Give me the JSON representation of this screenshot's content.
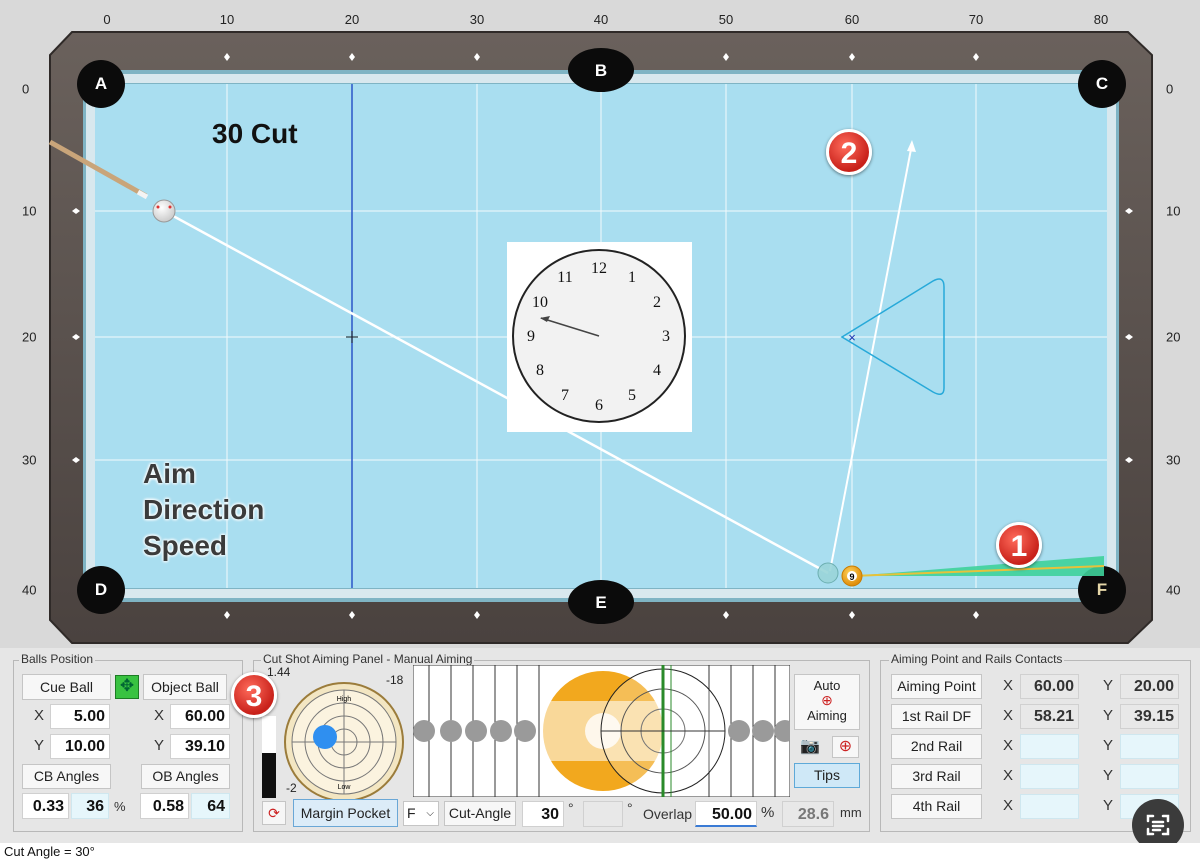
{
  "ruler": {
    "x_ticks": [
      "0",
      "10",
      "20",
      "30",
      "40",
      "50",
      "60",
      "70",
      "80"
    ],
    "y_ticks": [
      "0",
      "10",
      "20",
      "30",
      "40"
    ]
  },
  "pockets": {
    "a": "A",
    "b": "B",
    "c": "C",
    "d": "D",
    "e": "E",
    "f": "F"
  },
  "overlay": {
    "shot_title": "30 Cut",
    "aim_line1": "Aim",
    "aim_line2": "Direction",
    "aim_line3": "Speed",
    "badge1": "1",
    "badge2": "2",
    "badge3": "3"
  },
  "clock": {
    "numbers": [
      "12",
      "1",
      "2",
      "3",
      "4",
      "5",
      "6",
      "7",
      "8",
      "9",
      "10",
      "11"
    ]
  },
  "balls_position": {
    "title": "Balls Position",
    "cue_ball_label": "Cue Ball",
    "object_ball_label": "Object Ball",
    "x_label": "X",
    "y_label": "Y",
    "cue_x": "5.00",
    "cue_y": "10.00",
    "obj_x": "60.00",
    "obj_y": "39.10",
    "cb_angles_label": "CB Angles",
    "ob_angles_label": "OB Angles",
    "cb_angle1": "0.33",
    "cb_angle2": "36",
    "percent": "%",
    "ob_angle1": "0.58",
    "ob_angle2": "64"
  },
  "cut_panel": {
    "title": "Cut Shot Aiming Panel - Manual Aiming",
    "top_left_value": "1.44",
    "top_right_value": "-18",
    "bottom_left_value": "-2",
    "spin_chart_high": "High",
    "spin_chart_low": "Low",
    "auto_aiming": "Auto",
    "auto_aiming2": "Aiming",
    "tips_label": "Tips",
    "margin_pocket": "Margin Pocket",
    "select_value": "F",
    "cut_angle_label": "Cut-Angle",
    "cut_angle_value": "30",
    "degree": "°",
    "overlap_label": "Overlap",
    "overlap_value": "50.00",
    "percent": "%",
    "mm_value": "28.6",
    "mm_label": "mm",
    "ball_number": "9"
  },
  "aiming_point": {
    "title": "Aiming Point  and  Rails Contacts",
    "rows": [
      {
        "label": "Aiming Point",
        "x": "60.00",
        "y": "20.00"
      },
      {
        "label": "1st Rail DF",
        "x": "58.21",
        "y": "39.15"
      },
      {
        "label": "2nd Rail",
        "x": "",
        "y": ""
      },
      {
        "label": "3rd Rail",
        "x": "",
        "y": ""
      },
      {
        "label": "4th Rail",
        "x": "",
        "y": ""
      }
    ],
    "x_label": "X",
    "y_label": "Y"
  },
  "status": {
    "text": "Cut Angle = 30°"
  },
  "colors": {
    "felt": "#a9def0",
    "rail": "#5b5350",
    "badge": "#d6281f",
    "ob_ball": "#f2a81e"
  }
}
